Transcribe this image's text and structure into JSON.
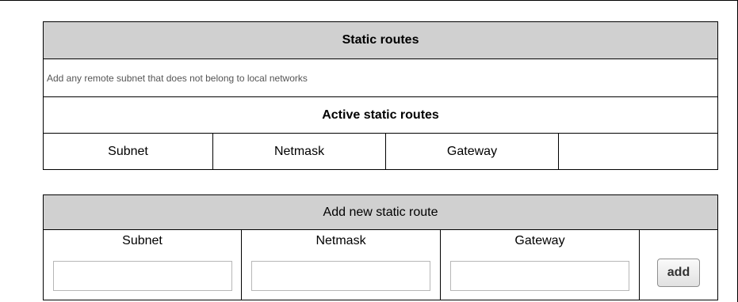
{
  "static_routes": {
    "title": "Static routes",
    "description": "Add any remote subnet that does not belong to local networks",
    "active_title": "Active static routes",
    "columns": [
      "Subnet",
      "Netmask",
      "Gateway",
      ""
    ]
  },
  "add_route": {
    "title": "Add new static route",
    "fields": [
      {
        "label": "Subnet",
        "value": "",
        "placeholder": ""
      },
      {
        "label": "Netmask",
        "value": "",
        "placeholder": ""
      },
      {
        "label": "Gateway",
        "value": "",
        "placeholder": ""
      }
    ],
    "add_label": "add"
  }
}
